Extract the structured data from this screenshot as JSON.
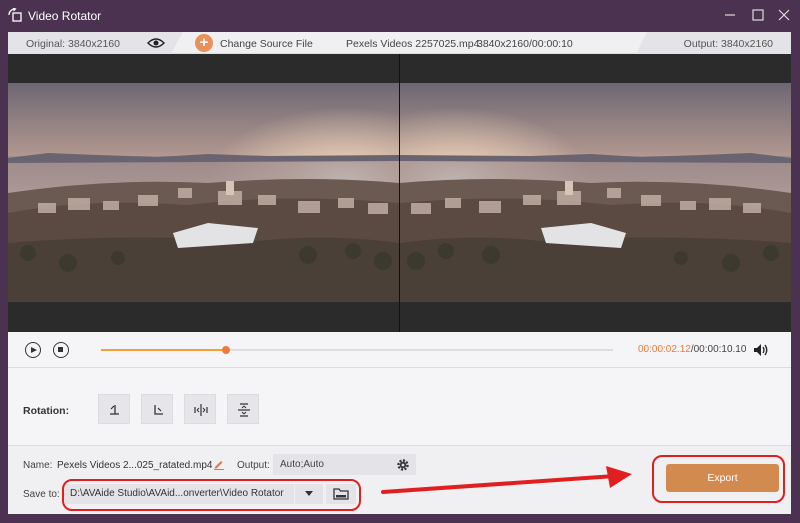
{
  "window": {
    "title": "Video Rotator"
  },
  "infobar": {
    "original": "Original: 3840x2160",
    "change_source": "Change Source File",
    "file_name": "Pexels Videos 2257025.mp4",
    "file_info": "3840x2160/00:00:10",
    "output": "Output: 3840x2160"
  },
  "player": {
    "current_time": "00:00:02.12",
    "total_time": "/00:00:10.10",
    "progress": 0.245
  },
  "rotation": {
    "label": "Rotation:",
    "buttons": [
      "rotate-left-icon",
      "rotate-right-icon",
      "flip-horizontal-icon",
      "flip-vertical-icon"
    ]
  },
  "bottom": {
    "name_label": "Name:",
    "name_value": "Pexels Videos 2...025_ratated.mp4",
    "output_label": "Output:",
    "output_value": "Auto;Auto",
    "save_label": "Save to:",
    "save_path": "D:\\AVAide Studio\\AVAid...onverter\\Video Rotator",
    "export_label": "Export"
  },
  "colors": {
    "window_frame": "#4a3250",
    "accent": "#f07a3a",
    "export_button": "#d28a4e",
    "annotation": "#e02020"
  }
}
